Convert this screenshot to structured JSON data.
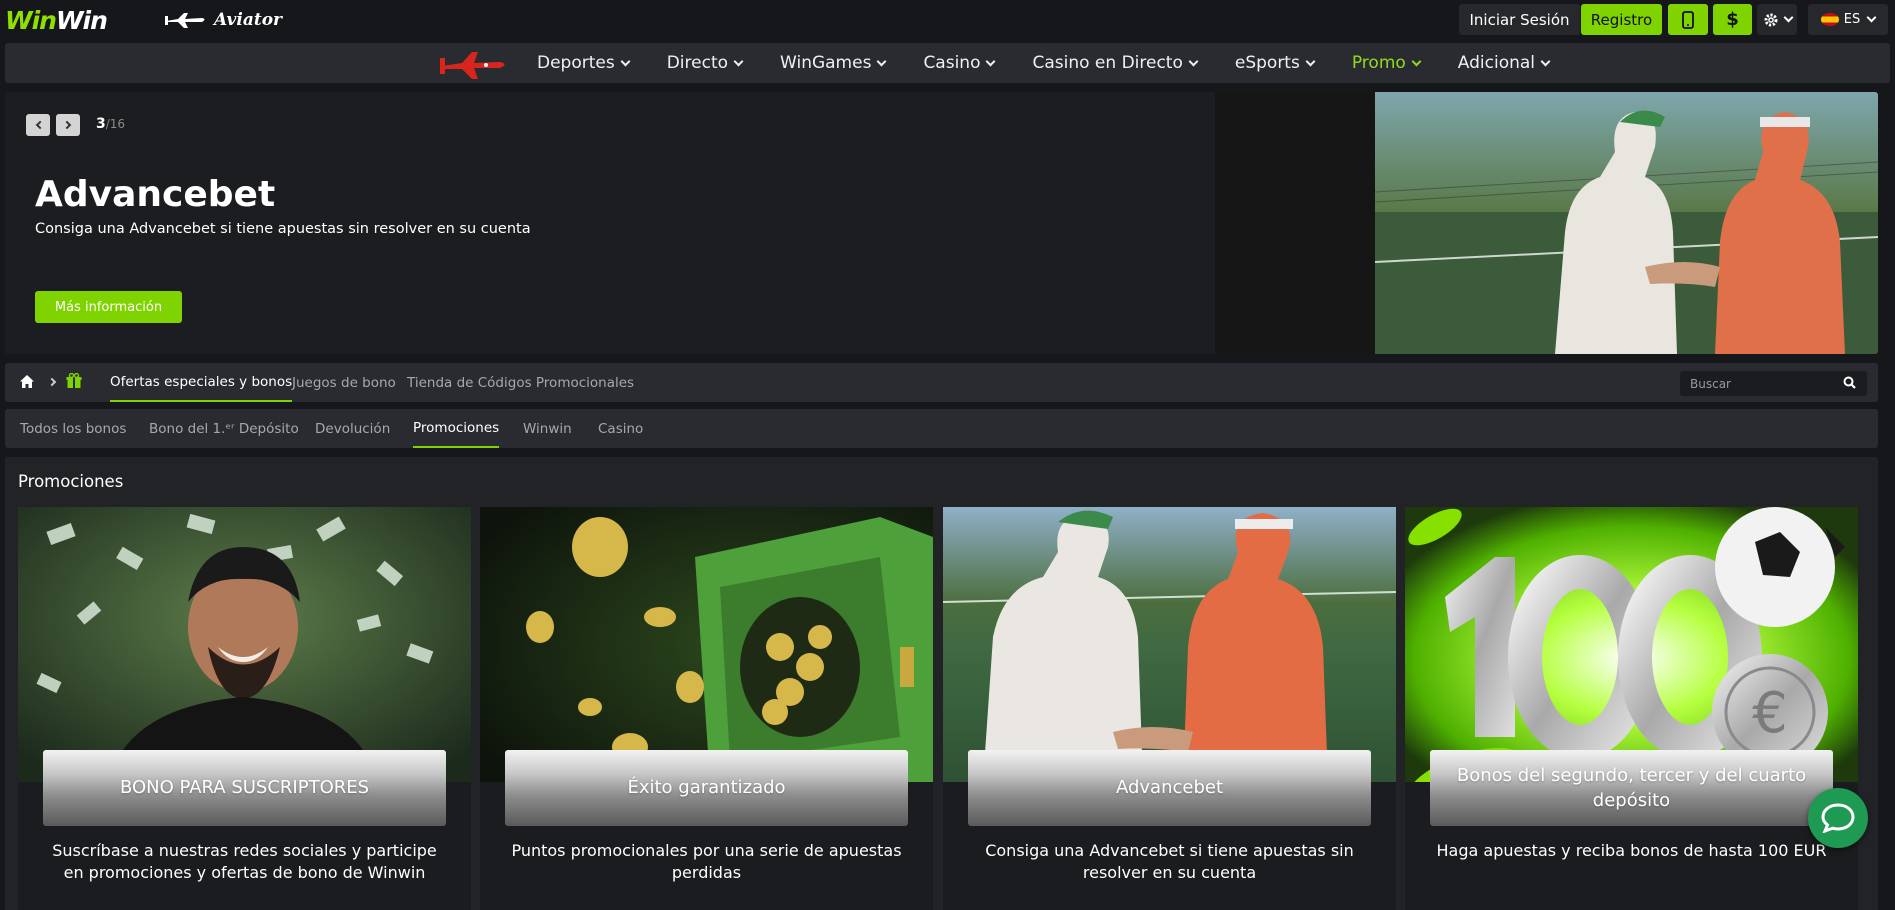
{
  "header": {
    "logo_part1": "Win",
    "logo_part2": "Win",
    "aviator_label": "Aviator",
    "login_label": "Iniciar Sesión",
    "register_label": "Registro",
    "language_label": "ES",
    "accent_color": "#7fd300"
  },
  "nav": {
    "items": [
      {
        "label": "Deportes"
      },
      {
        "label": "Directo"
      },
      {
        "label": "WinGames"
      },
      {
        "label": "Casino"
      },
      {
        "label": "Casino en Directo"
      },
      {
        "label": "eSports"
      },
      {
        "label": "Promo"
      },
      {
        "label": "Adicional"
      }
    ],
    "active_item": "Promo"
  },
  "hero": {
    "current": "3",
    "total": "/16",
    "title": "Advancebet",
    "subtitle": "Consiga una Advancebet si tiene apuestas sin resolver en su cuenta",
    "button_label": "Más información"
  },
  "breadcrumb": {
    "tabs": [
      {
        "label": "Ofertas especiales y bonos"
      },
      {
        "label": "Juegos de bono"
      },
      {
        "label": "Tienda de Códigos Promocionales"
      }
    ],
    "active_tab": "Ofertas especiales y bonos",
    "search_placeholder": "Buscar"
  },
  "filters": {
    "tabs": [
      {
        "label": "Todos los bonos"
      },
      {
        "label": "Bono del 1.ᵉʳ Depósito"
      },
      {
        "label": "Devolución"
      },
      {
        "label": "Promociones"
      },
      {
        "label": "Winwin"
      },
      {
        "label": "Casino"
      }
    ],
    "active_tab": "Promociones"
  },
  "section": {
    "title": "Promociones",
    "cards": [
      {
        "title": "BONO PARA SUSCRIPTORES",
        "description": "Suscríbase a nuestras redes sociales y participe en promociones y ofertas de bono de Winwin"
      },
      {
        "title": "Éxito garantizado",
        "description": "Puntos promocionales por una serie de apuestas perdidas"
      },
      {
        "title": "Advancebet",
        "description": "Consiga una Advancebet si tiene apuestas sin resolver en su cuenta"
      },
      {
        "title": "Bonos del segundo, tercer y del cuarto depósito",
        "description": "Haga apuestas y reciba bonos de hasta 100 EUR"
      }
    ]
  }
}
